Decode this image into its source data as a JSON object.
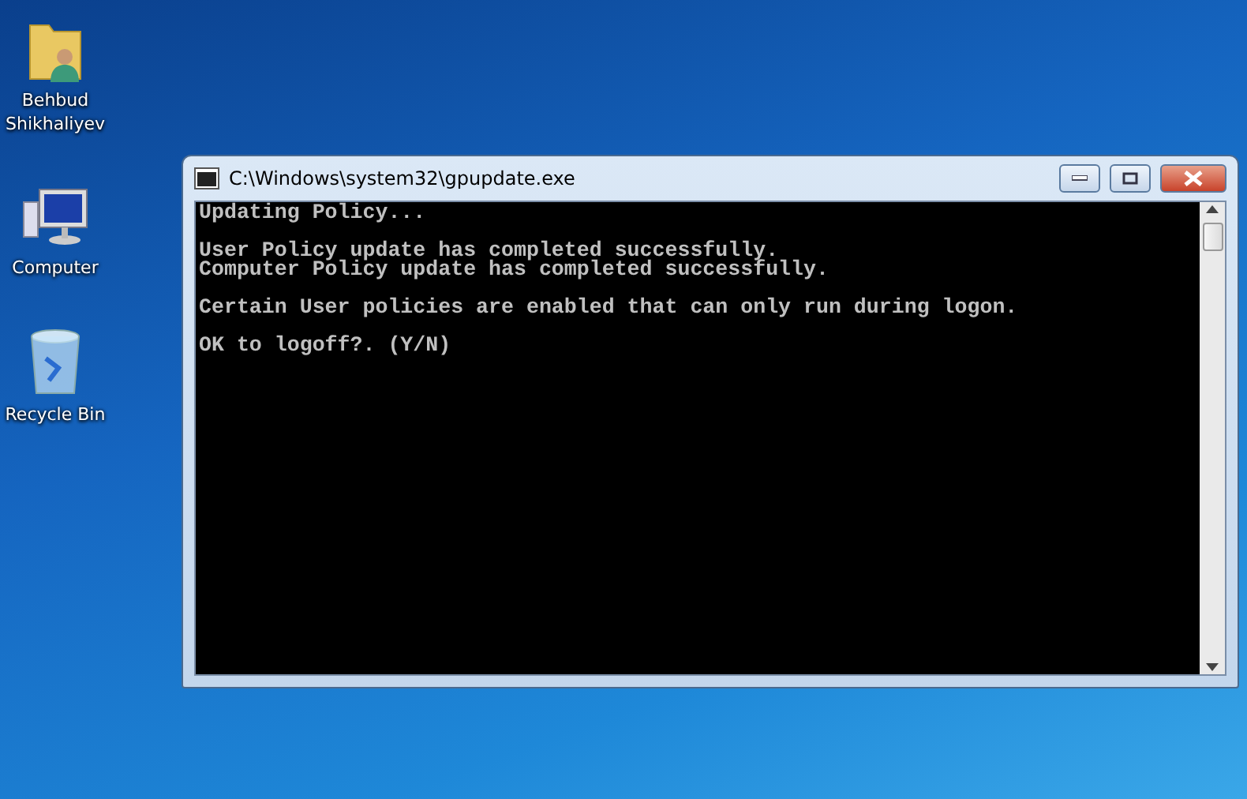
{
  "desktop_icons": [
    {
      "kind": "user-folder",
      "label": "Behbud Shikhaliyev"
    },
    {
      "kind": "computer",
      "label": "Computer"
    },
    {
      "kind": "recycle-bin",
      "label": "Recycle Bin"
    }
  ],
  "window": {
    "title": "C:\\Windows\\system32\\gpupdate.exe",
    "console_blocks": [
      [
        "Updating Policy..."
      ],
      [
        "User Policy update has completed successfully.",
        "Computer Policy update has completed successfully."
      ],
      [
        "Certain User policies are enabled that can only run during logon."
      ],
      [
        "OK to logoff?. (Y/N)"
      ]
    ]
  }
}
